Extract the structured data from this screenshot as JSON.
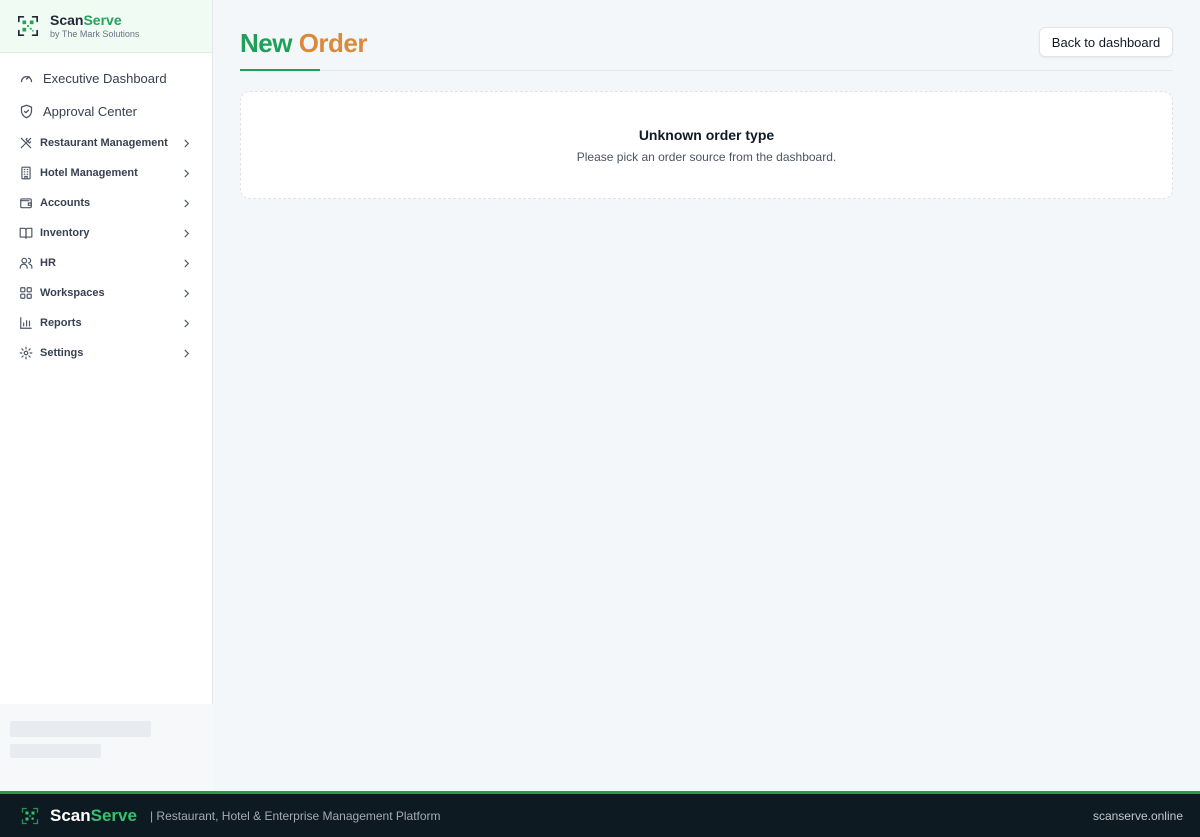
{
  "brand": {
    "name_part1": "Scan",
    "name_part2": "Serve",
    "subtitle": "by The Mark Solutions",
    "accent_color": "#22a35a"
  },
  "sidebar": {
    "top_items": [
      {
        "label": "Executive Dashboard",
        "icon": "gauge-icon"
      },
      {
        "label": "Approval Center",
        "icon": "shield-check-icon"
      }
    ],
    "groups": [
      {
        "label": "Restaurant Management",
        "icon": "utensils-icon"
      },
      {
        "label": "Hotel Management",
        "icon": "building-icon"
      },
      {
        "label": "Accounts",
        "icon": "wallet-icon"
      },
      {
        "label": "Inventory",
        "icon": "book-icon"
      },
      {
        "label": "HR",
        "icon": "users-icon"
      },
      {
        "label": "Workspaces",
        "icon": "grid-icon"
      },
      {
        "label": "Reports",
        "icon": "bar-chart-icon"
      },
      {
        "label": "Settings",
        "icon": "gear-icon"
      }
    ]
  },
  "page": {
    "title_part1": "New ",
    "title_part2": "Order",
    "back_button": "Back to dashboard",
    "empty_title": "Unknown order type",
    "empty_subtitle": "Please pick an order source from the dashboard."
  },
  "footer": {
    "brand_part1": "Scan",
    "brand_part2": "Serve",
    "tagline": "| Restaurant, Hotel & Enterprise Management Platform",
    "site": "scanserve.online"
  }
}
